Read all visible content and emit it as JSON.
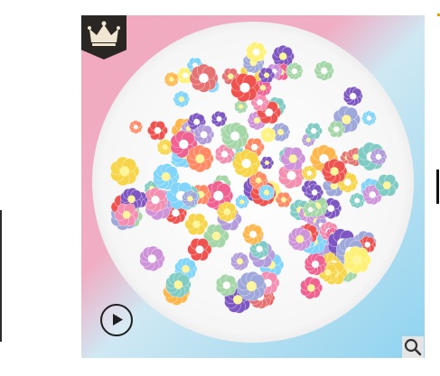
{
  "product_image": {
    "alt": "",
    "colors": {
      "background_pink": "#f1a9bf",
      "background_blue": "#8fd3ef",
      "plate": "#fbfbfb"
    }
  },
  "icons": {
    "brand": "crown-icon",
    "play": "play-icon",
    "zoom": "magnifier-icon"
  },
  "accent": "#e8a200"
}
